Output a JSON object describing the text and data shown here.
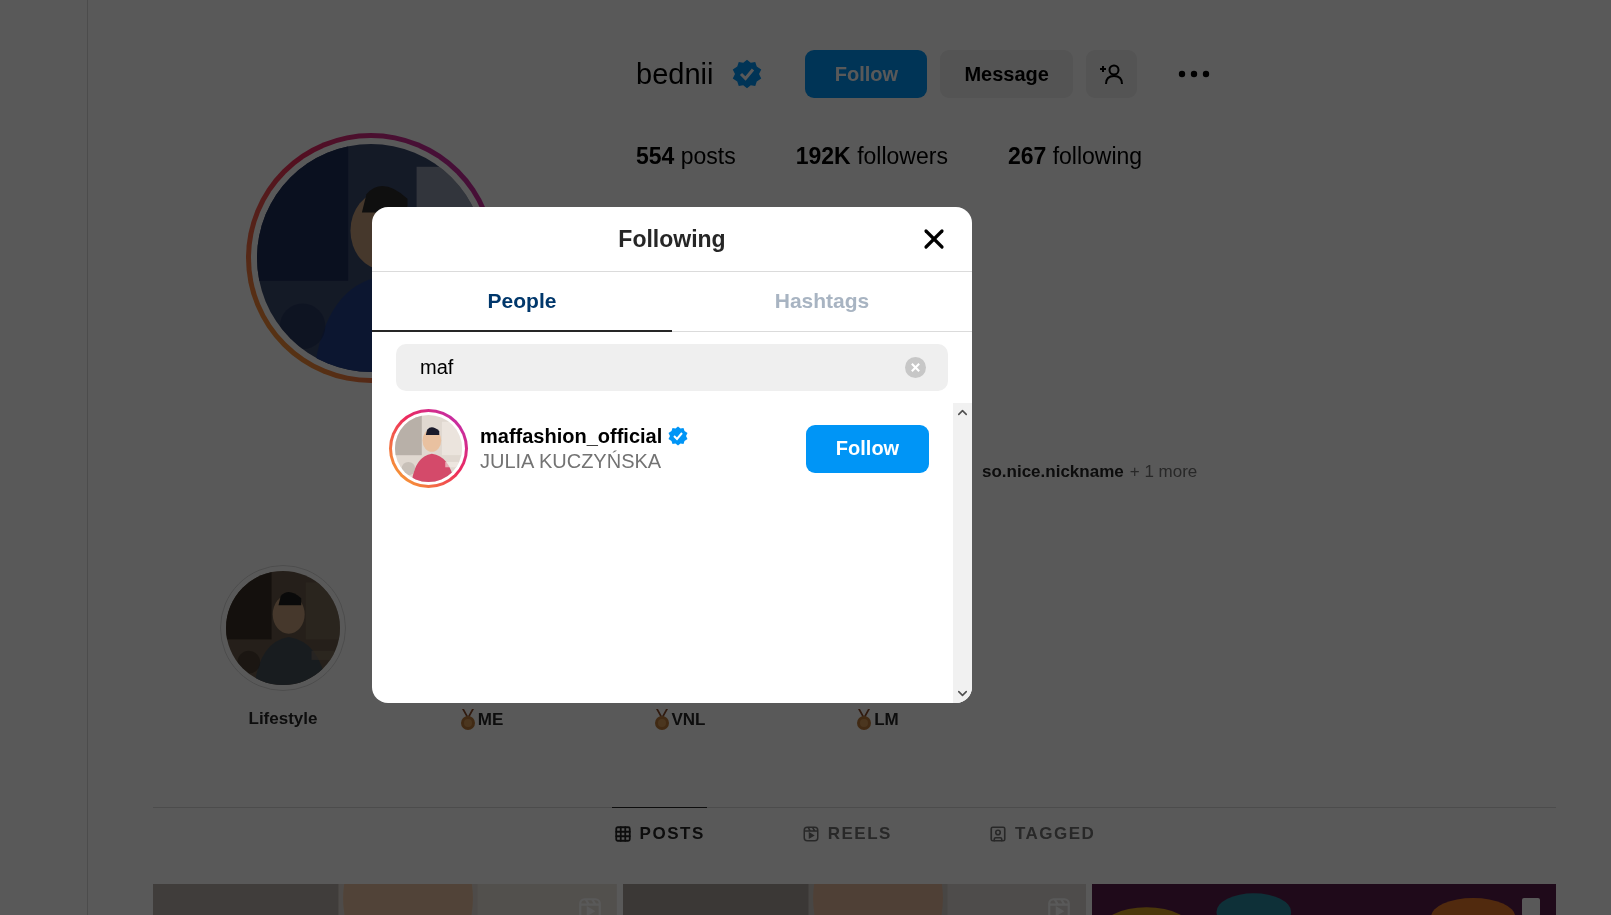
{
  "profile": {
    "username": "bednii",
    "verified": true,
    "actions": [
      {
        "kind": "primary",
        "label": "Follow"
      },
      {
        "kind": "secondary",
        "label": "Message"
      },
      {
        "kind": "add-person"
      },
      {
        "kind": "more"
      }
    ],
    "stats": [
      {
        "count": "554",
        "label": "posts"
      },
      {
        "count": "192K",
        "label": "followers"
      },
      {
        "count": "267",
        "label": "following"
      }
    ],
    "followed_by": {
      "name": "so.nice.nickname",
      "more": "+ 1 more"
    }
  },
  "highlights": [
    {
      "kind": "picture",
      "label": "Lifestyle"
    },
    {
      "kind": "medal",
      "label": "ME"
    },
    {
      "kind": "medal",
      "label": "VNL"
    },
    {
      "kind": "medal",
      "label": "LM"
    }
  ],
  "profile_tabs": [
    {
      "kind": "grid",
      "label": "POSTS",
      "selected": true
    },
    {
      "kind": "reels",
      "label": "REELS",
      "selected": false
    },
    {
      "kind": "tagged",
      "label": "TAGGED",
      "selected": false
    }
  ],
  "posts": [
    {
      "kind": "reel"
    },
    {
      "kind": "reel"
    },
    {
      "kind": "carousel"
    }
  ],
  "dialog": {
    "title": "Following",
    "tabs": [
      {
        "label": "People",
        "selected": true
      },
      {
        "label": "Hashtags",
        "selected": false
      }
    ],
    "search": {
      "value": "maf"
    },
    "results": [
      {
        "username": "maffashion_official",
        "verified": true,
        "full_name": "JULIA KUCZYŃSKA",
        "button": "Follow"
      }
    ]
  }
}
